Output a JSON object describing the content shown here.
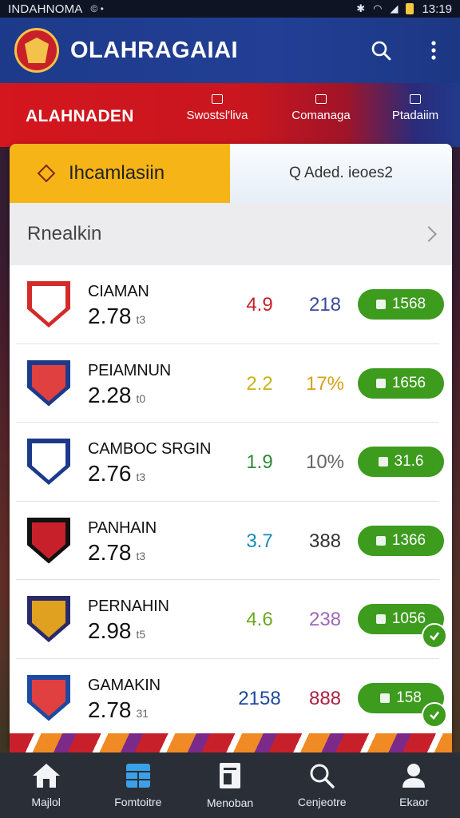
{
  "status_bar": {
    "carrier": "INDAHNOMA",
    "mini": "©  •",
    "time": "13:19"
  },
  "app_bar": {
    "title": "OLAHRAGAIAI"
  },
  "category_strip": {
    "main": "ALAHNADEN",
    "items": [
      {
        "label": "Swostsl'liva"
      },
      {
        "label": "Comanaga"
      },
      {
        "label": "Ptadaiim"
      }
    ]
  },
  "segmented": {
    "tab_a": "Ihcamlasiin",
    "tab_b": "Q Aded. ieoes2"
  },
  "section": {
    "title": "Rnealkin"
  },
  "teams": [
    {
      "name": "CIAMAN",
      "odds": "2.78",
      "sub": "t3",
      "val1": "4.9",
      "val1_color": "#c8202a",
      "val2": "218",
      "val2_color": "#3a4aa0",
      "pill": "1568",
      "crest_color": "#d42a2a",
      "crest_inner": "#ffffff",
      "check": false
    },
    {
      "name": "PEIAMNUN",
      "odds": "2.28",
      "sub": "t0",
      "val1": "2.2",
      "val1_color": "#cbb21a",
      "val2": "17%",
      "val2_color": "#d6a21a",
      "pill": "1656",
      "crest_color": "#1d3a8a",
      "crest_inner": "#e04040",
      "check": false
    },
    {
      "name": "CAMBOC SRGIN",
      "odds": "2.76",
      "sub": "t3",
      "val1": "1.9",
      "val1_color": "#2e8a3a",
      "val2": "10%",
      "val2_color": "#666666",
      "pill": "31.6",
      "crest_color": "#1d3a8a",
      "crest_inner": "#ffffff",
      "check": false
    },
    {
      "name": "PANHAIN",
      "odds": "2.78",
      "sub": "t3",
      "val1": "3.7",
      "val1_color": "#1a8ab8",
      "val2": "388",
      "val2_color": "#333333",
      "pill": "1366",
      "crest_color": "#111111",
      "crest_inner": "#c8202a",
      "check": false
    },
    {
      "name": "PERNAHIN",
      "odds": "2.98",
      "sub": "t5",
      "val1": "4.6",
      "val1_color": "#6aa81e",
      "val2": "238",
      "val2_color": "#a066b8",
      "pill": "1056",
      "crest_color": "#2a2a6a",
      "crest_inner": "#e0a020",
      "check": true
    },
    {
      "name": "GAMAKIN",
      "odds": "2.78",
      "sub": "31",
      "val1": "2158",
      "val1_color": "#1d4aa0",
      "val2": "888",
      "val2_color": "#b02040",
      "pill": "158",
      "crest_color": "#1d4aa0",
      "crest_inner": "#e04040",
      "check": true
    }
  ],
  "bottom_nav": [
    {
      "label": "Majlol",
      "icon": "home-icon"
    },
    {
      "label": "Fomtoitre",
      "icon": "grid-icon"
    },
    {
      "label": "Menoban",
      "icon": "document-icon"
    },
    {
      "label": "Cenjeotre",
      "icon": "search-icon"
    },
    {
      "label": "Ekaor",
      "icon": "profile-icon"
    }
  ]
}
